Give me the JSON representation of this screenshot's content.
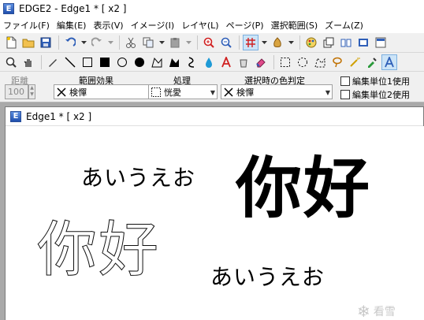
{
  "window": {
    "title": "EDGE2 - Edge1 * [ x2 ]",
    "app_icon_letter": "E"
  },
  "menubar": {
    "items": [
      "ファイル(F)",
      "編集(E)",
      "表示(V)",
      "イメージ(I)",
      "レイヤ(L)",
      "ページ(P)",
      "選択範囲(S)",
      "ズーム(Z)"
    ]
  },
  "options": {
    "distance_label": "距離",
    "distance_value": "100",
    "range_effect_label": "範囲効果",
    "range_effect_value": "検憚",
    "processing_label": "処理",
    "processing_value": "恍愛",
    "color_judge_label": "選択時の色判定",
    "color_judge_value": "検憚",
    "checkbox1_label": "編集単位1使用",
    "checkbox2_label": "編集単位2使用"
  },
  "document": {
    "title": "Edge1 * [ x2 ]",
    "icon_letter": "E"
  },
  "canvas": {
    "kana_top": "あいうえお",
    "kanji_filled": "你好",
    "kanji_outline": "你好",
    "kana_bottom": "あいうえお"
  },
  "watermark": {
    "text": "看雪"
  },
  "colors": {
    "toolbar_bg": "#f0f0f0",
    "workspace_bg": "#a9a9a9",
    "accent": "#1f4fae"
  }
}
